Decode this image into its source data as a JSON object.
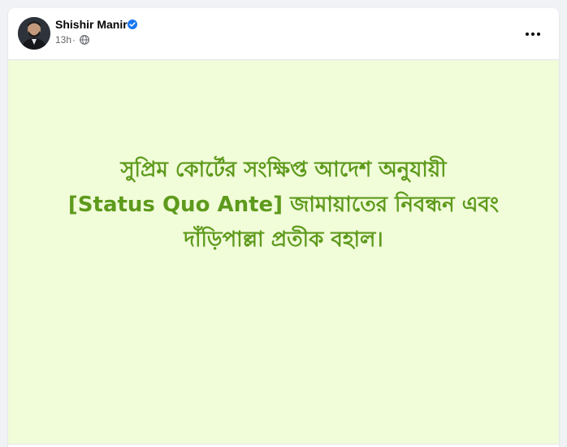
{
  "post": {
    "author": "Shishir Manir",
    "time": "13h",
    "separator": "·",
    "icons": {
      "verified": "verified-badge-icon",
      "audience": "globe-icon",
      "more": "more-options-icon",
      "avatar": "avatar"
    },
    "colors": {
      "background": "#f1fcd9",
      "text": "#5e9a1c",
      "verified": "#1877f2"
    },
    "lines": [
      "সুপ্রিম কোর্টের সংক্ষিপ্ত আদেশ অনুযায়ী",
      "[Status Quo Ante] জামায়াতের নিবন্ধন এবং",
      "দাঁড়িপাল্লা প্রতীক বহাল।"
    ]
  }
}
